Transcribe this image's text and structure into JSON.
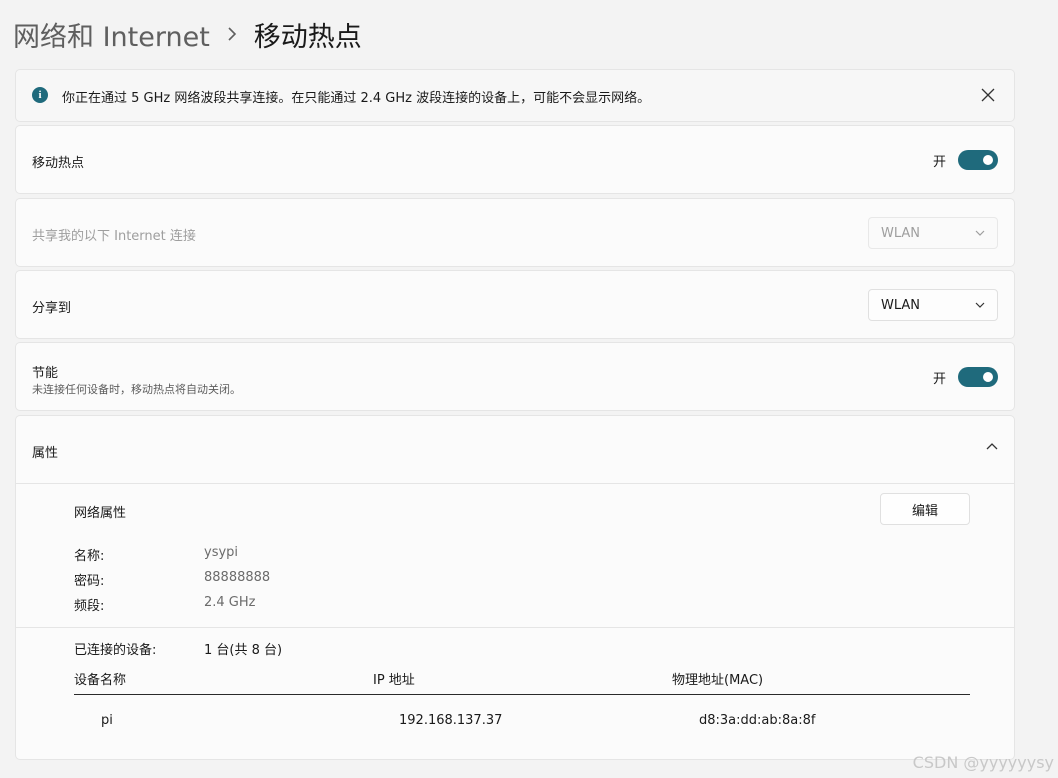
{
  "breadcrumb": {
    "parent": "网络和 Internet",
    "separator_icon": "chevron-right",
    "current": "移动热点"
  },
  "info_bar": {
    "icon": "info-icon",
    "text": "你正在通过 5 GHz 网络波段共享连接。在只能通过 2.4 GHz 波段连接的设备上，可能不会显示网络。",
    "close_icon": "close-icon"
  },
  "hotspot": {
    "label": "移动热点",
    "toggle_label": "开",
    "on": true
  },
  "share_from": {
    "label": "共享我的以下 Internet 连接",
    "value": "WLAN",
    "disabled": true
  },
  "share_to": {
    "label": "分享到",
    "value": "WLAN"
  },
  "power_saving": {
    "label": "节能",
    "description": "未连接任何设备时，移动热点将自动关闭。",
    "toggle_label": "开",
    "on": true
  },
  "properties": {
    "header": "属性",
    "section_title": "网络属性",
    "edit_label": "编辑",
    "name_label": "名称:",
    "name_value": "ysypi",
    "password_label": "密码:",
    "password_value": "88888888",
    "band_label": "频段:",
    "band_value": "2.4 GHz",
    "connected_label": "已连接的设备:",
    "connected_value": "1 台(共 8 台)",
    "columns": [
      "设备名称",
      "IP 地址",
      "物理地址(MAC)"
    ],
    "devices": [
      {
        "name": "pi",
        "ip": "192.168.137.37",
        "mac": "d8:3a:dd:ab:8a:8f"
      }
    ]
  },
  "colors": {
    "accent": "#1f6a7c",
    "background": "#f3f3f3",
    "card": "#fbfbfb"
  },
  "watermark": "CSDN @yyyyyysy"
}
